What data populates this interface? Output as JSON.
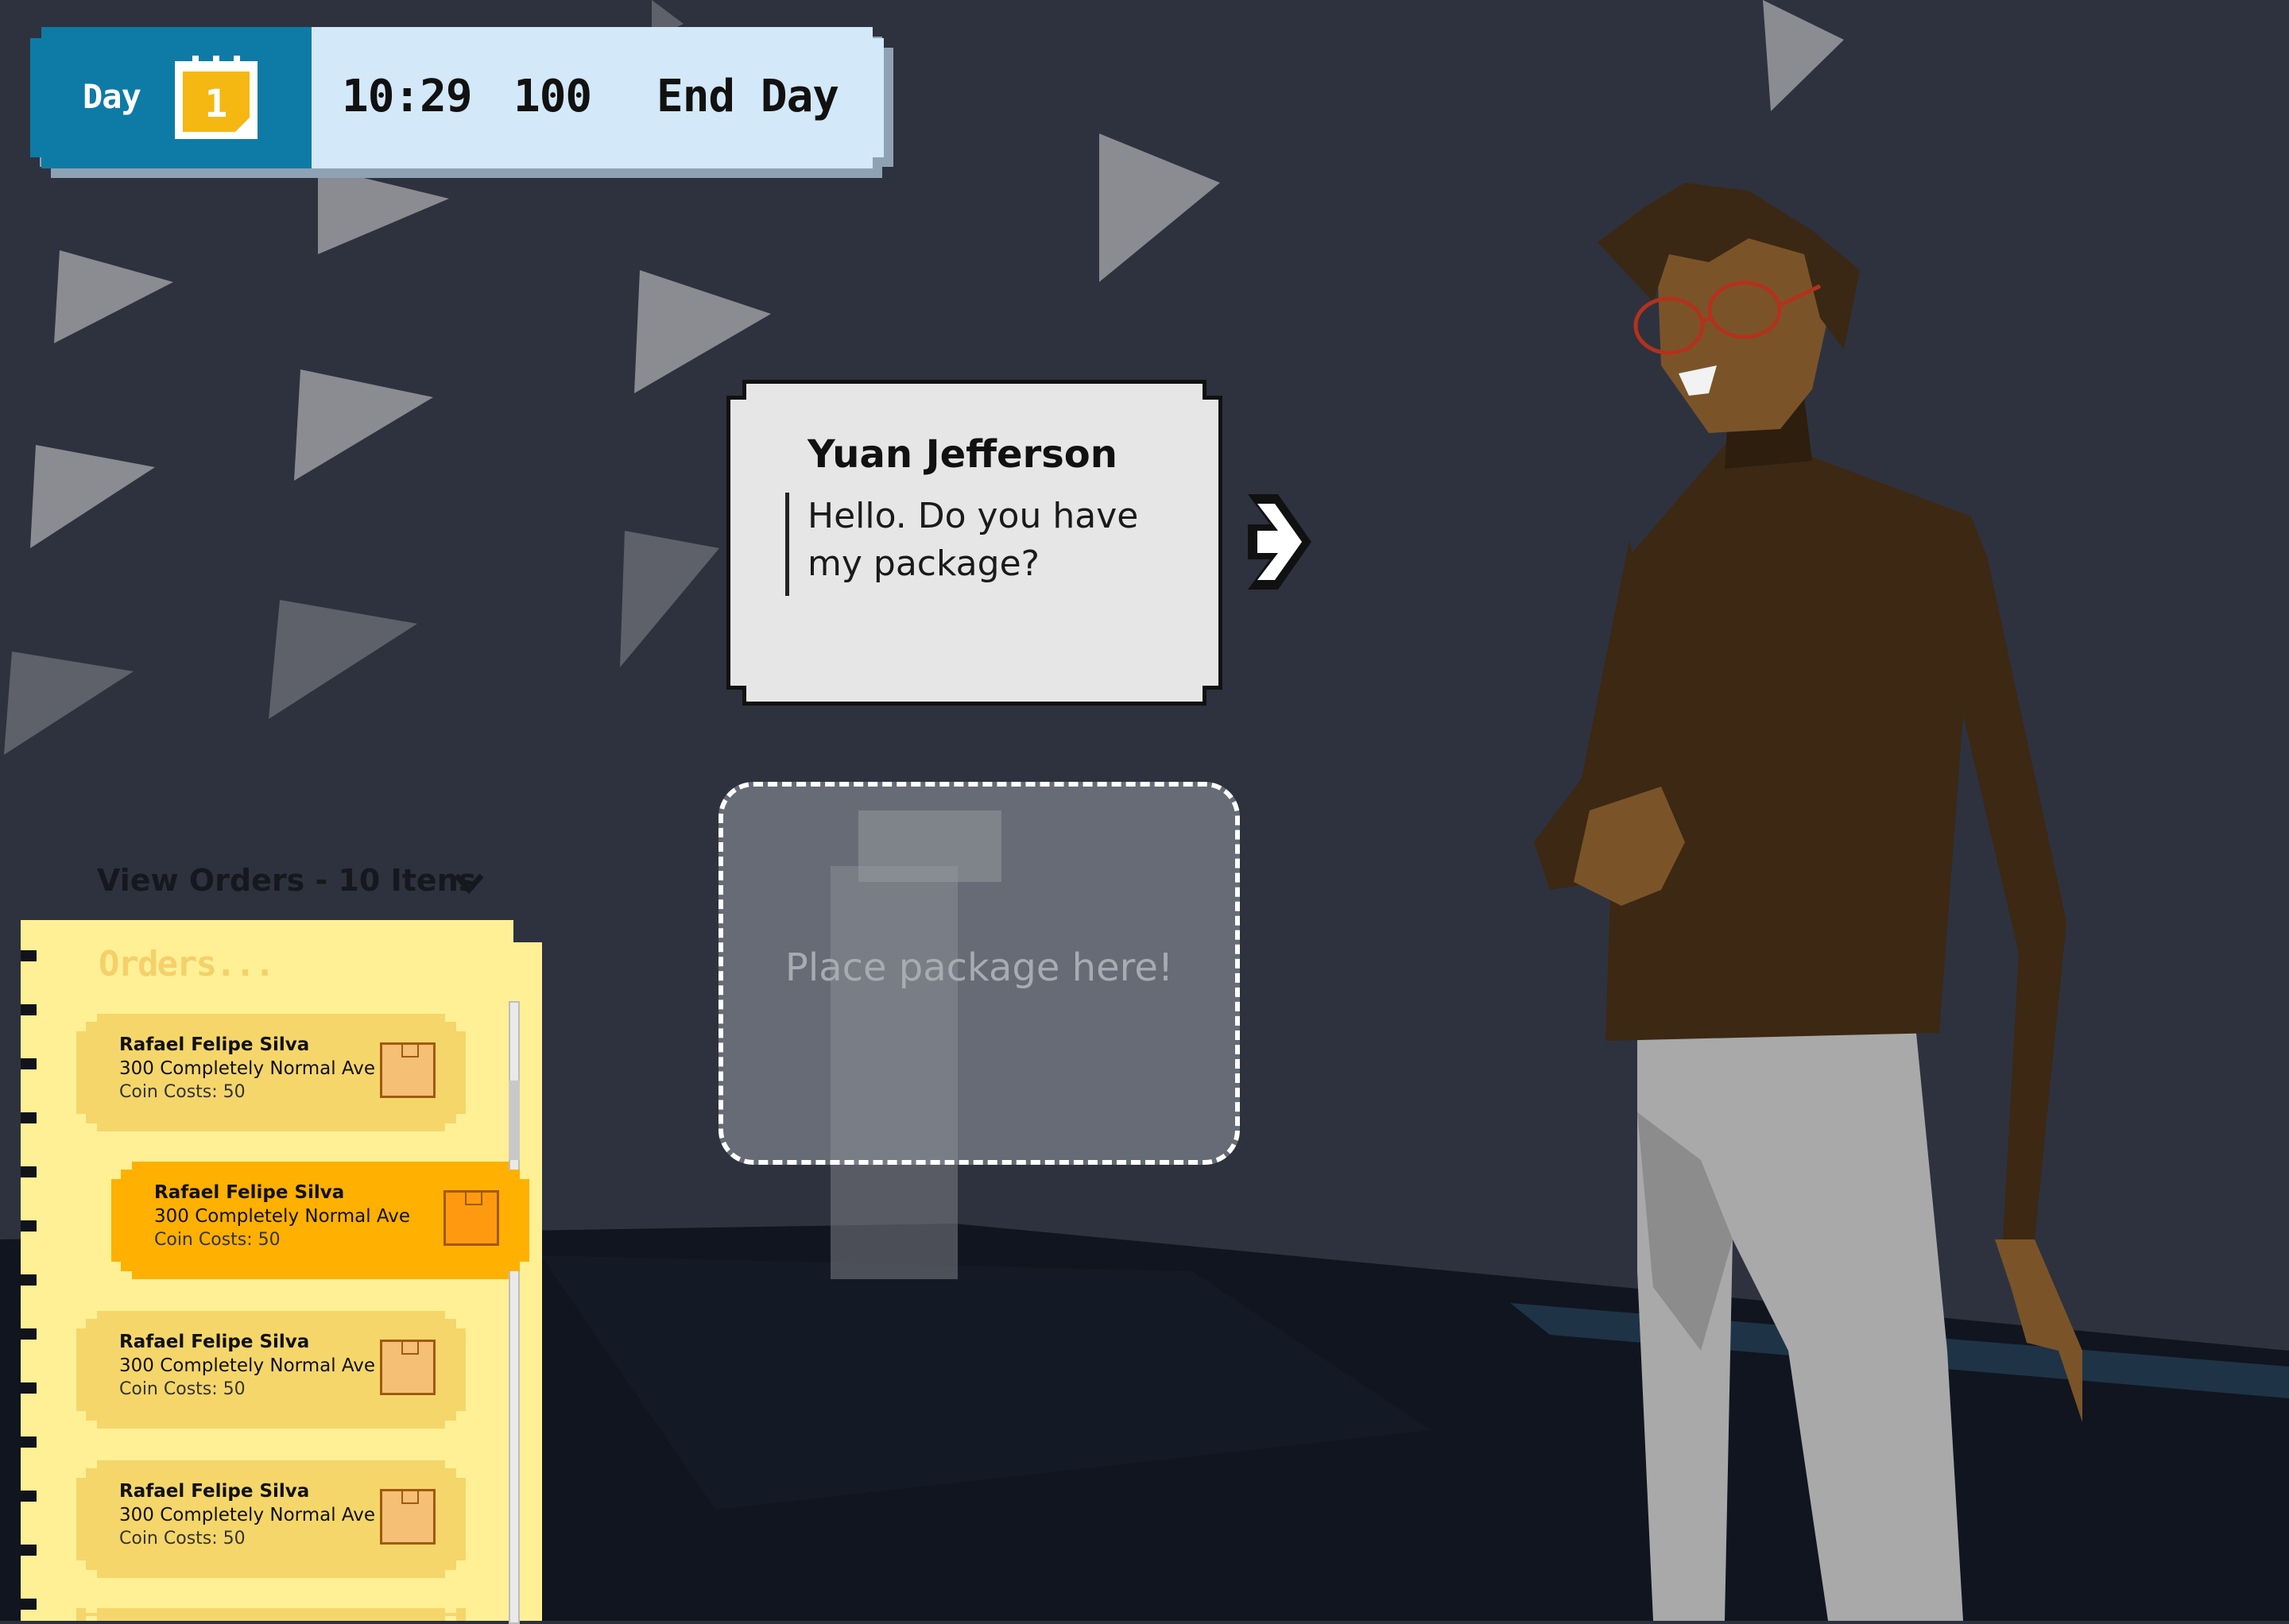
{
  "hud": {
    "day_label": "Day",
    "day_number": "1",
    "time": "10:29",
    "coins": "100",
    "end_day_label": "End Day"
  },
  "dialogue": {
    "speaker": "Yuan Jefferson",
    "line": "Hello. Do you have my package?"
  },
  "drop_zone": {
    "hint": "Place package here!"
  },
  "orders": {
    "toggle_label": "View Orders - 10 Itens",
    "notebook_title": "Orders...",
    "items": [
      {
        "name": "Rafael Felipe Silva",
        "address": "300 Completely Normal Ave",
        "cost": "Coin Costs: 50",
        "selected": false
      },
      {
        "name": "Rafael Felipe Silva",
        "address": "300 Completely Normal Ave",
        "cost": "Coin Costs: 50",
        "selected": true
      },
      {
        "name": "Rafael Felipe Silva",
        "address": "300 Completely Normal Ave",
        "cost": "Coin Costs: 50",
        "selected": false
      },
      {
        "name": "Rafael Felipe Silva",
        "address": "300 Completely Normal Ave",
        "cost": "Coin Costs: 50",
        "selected": false
      }
    ]
  },
  "icons": [
    "calendar-icon",
    "next-arrow-icon",
    "chevron-down-icon",
    "package-icon"
  ],
  "colors": {
    "hud_day_bg": "#0e7ba6",
    "hud_bg": "#d3e8f8",
    "notebook_bg": "#fff096",
    "order_card": "#f5d66a",
    "order_card_selected": "#ffb000",
    "background": "#2d313d"
  }
}
